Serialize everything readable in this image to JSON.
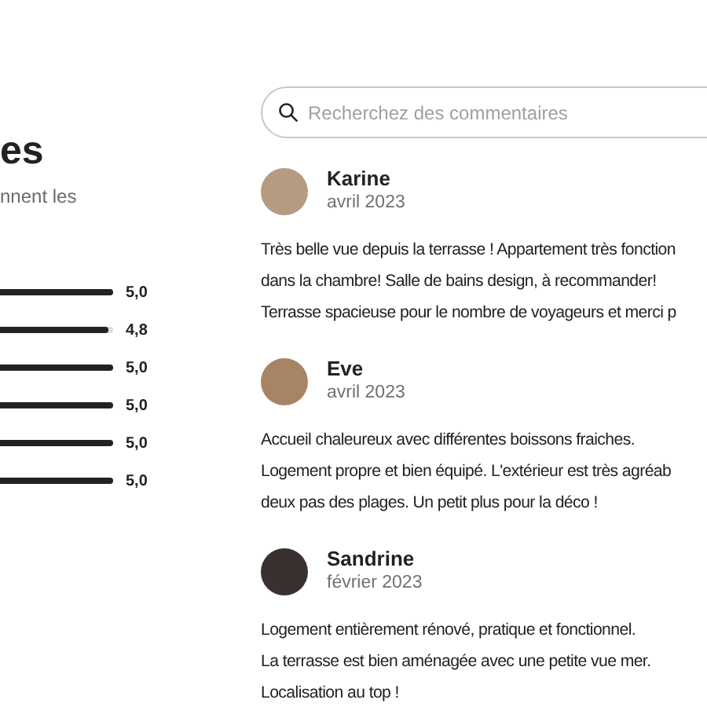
{
  "summary": {
    "title": "es",
    "subtitle": "nnent les",
    "ratings": [
      {
        "level": 1.0,
        "value": "5,0"
      },
      {
        "level": 0.96,
        "value": "4,8"
      },
      {
        "level": 1.0,
        "value": "5,0"
      },
      {
        "level": 1.0,
        "value": "5,0"
      },
      {
        "level": 1.0,
        "value": "5,0"
      },
      {
        "level": 1.0,
        "value": "5,0"
      }
    ]
  },
  "search": {
    "placeholder": "Recherchez des commentaires"
  },
  "reviews": [
    {
      "name": "Karine",
      "date": "avril 2023",
      "lines": [
        "Très belle vue depuis la terrasse ! Appartement très fonction",
        "dans la chambre! Salle de bains design, à recommander!",
        "Terrasse spacieuse pour le nombre de voyageurs et merci p"
      ]
    },
    {
      "name": "Eve",
      "date": "avril 2023",
      "lines": [
        "Accueil chaleureux avec différentes boissons fraiches.",
        "Logement propre et bien équipé. L'extérieur est très agréab",
        "deux pas des plages. Un petit plus pour la déco !"
      ]
    },
    {
      "name": "Sandrine",
      "date": "février 2023",
      "lines": [
        "Logement entièrement rénové, pratique et fonctionnel.",
        "La terrasse est bien aménagée avec une petite vue mer.",
        "Localisation au top !"
      ]
    }
  ]
}
